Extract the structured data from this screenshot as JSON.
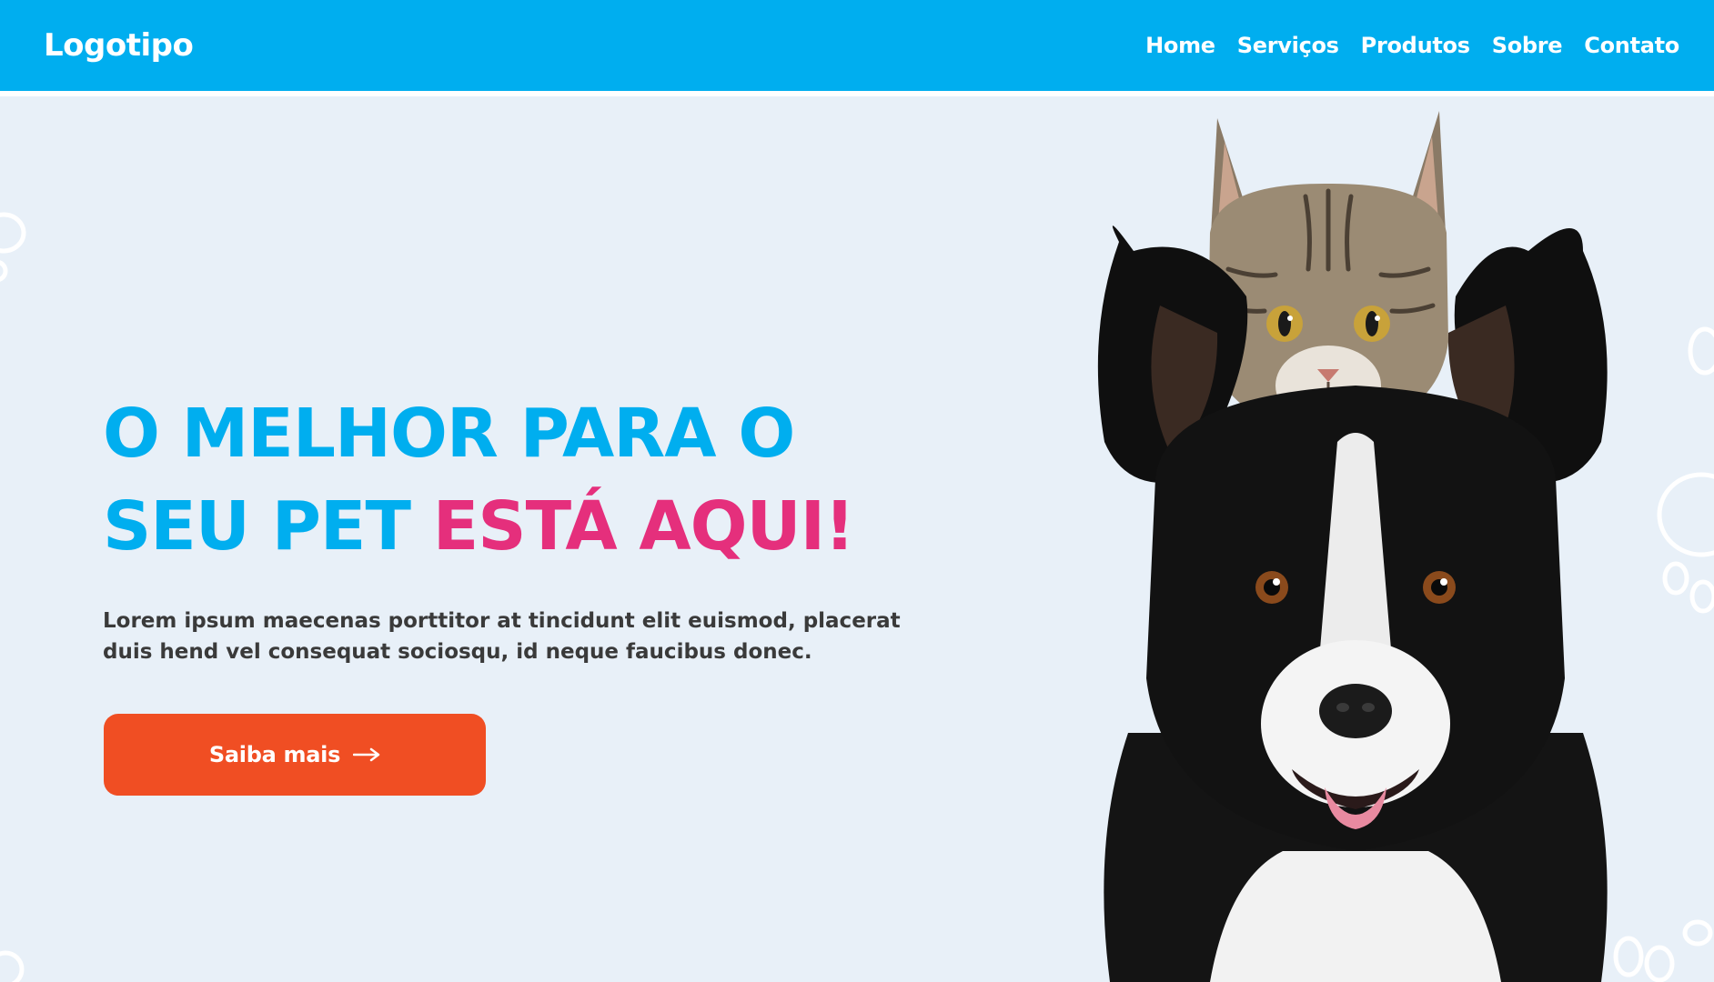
{
  "header": {
    "logo": "Logotipo",
    "nav": [
      "Home",
      "Serviços",
      "Produtos",
      "Sobre",
      "Contato"
    ]
  },
  "hero": {
    "headline": {
      "line1": "O MELHOR PARA O",
      "line2_blue": "SEU PET ",
      "line2_pink": "ESTÁ AQUI!"
    },
    "description": "Lorem ipsum maecenas porttitor at tincidunt elit euismod, placerat duis hend vel consequat sociosqu, id neque faucibus donec.",
    "cta": {
      "label": "Saiba mais",
      "icon": "arrow-right-icon"
    },
    "image": {
      "subject": "cat-and-dog-photo"
    },
    "decorations": [
      "paw-print-icon"
    ]
  },
  "colors": {
    "brand_blue": "#00aeef",
    "accent_pink": "#e52f7c",
    "cta_orange": "#f04e23",
    "background": "#e8f0f8",
    "body_text": "#3a3a3a"
  }
}
